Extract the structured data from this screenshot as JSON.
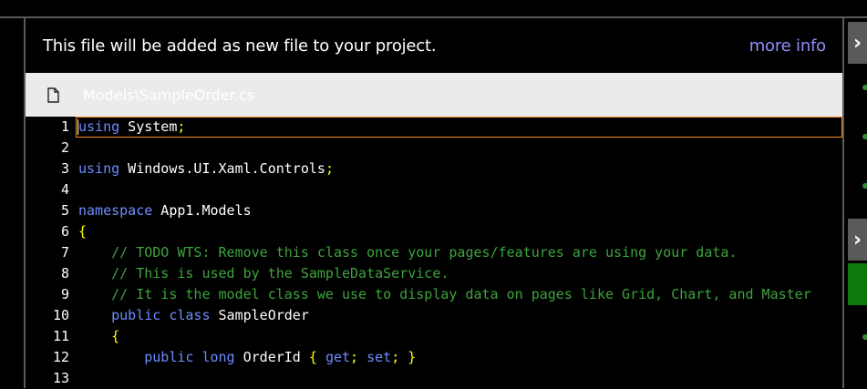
{
  "banner": {
    "message": "This file will be added as new file to your project.",
    "more_info_label": "more info"
  },
  "file": {
    "icon": "document-icon",
    "name": "Models\\SampleOrder.cs"
  },
  "editor": {
    "current_line": 1,
    "lines": [
      {
        "num": "1",
        "tokens": [
          {
            "t": "using",
            "c": "k"
          },
          {
            "t": " System",
            "c": "n"
          },
          {
            "t": ";",
            "c": "p"
          }
        ]
      },
      {
        "num": "2",
        "tokens": []
      },
      {
        "num": "3",
        "tokens": [
          {
            "t": "using",
            "c": "k"
          },
          {
            "t": " Windows.UI.Xaml.Controls",
            "c": "n"
          },
          {
            "t": ";",
            "c": "p"
          }
        ]
      },
      {
        "num": "4",
        "tokens": []
      },
      {
        "num": "5",
        "tokens": [
          {
            "t": "namespace",
            "c": "k"
          },
          {
            "t": " App1.Models",
            "c": "n"
          }
        ]
      },
      {
        "num": "6",
        "tokens": [
          {
            "t": "{",
            "c": "p"
          }
        ]
      },
      {
        "num": "7",
        "tokens": [
          {
            "t": "    ",
            "c": "n"
          },
          {
            "t": "// TODO WTS: Remove this class once your pages/features are using your data.",
            "c": "c"
          }
        ]
      },
      {
        "num": "8",
        "tokens": [
          {
            "t": "    ",
            "c": "n"
          },
          {
            "t": "// This is used by the SampleDataService.",
            "c": "c"
          }
        ]
      },
      {
        "num": "9",
        "tokens": [
          {
            "t": "    ",
            "c": "n"
          },
          {
            "t": "// It is the model class we use to display data on pages like Grid, Chart, and Master",
            "c": "c"
          }
        ]
      },
      {
        "num": "10",
        "tokens": [
          {
            "t": "    ",
            "c": "n"
          },
          {
            "t": "public",
            "c": "k"
          },
          {
            "t": " ",
            "c": "n"
          },
          {
            "t": "class",
            "c": "k"
          },
          {
            "t": " SampleOrder",
            "c": "n"
          }
        ]
      },
      {
        "num": "11",
        "tokens": [
          {
            "t": "    ",
            "c": "n"
          },
          {
            "t": "{",
            "c": "p"
          }
        ]
      },
      {
        "num": "12",
        "tokens": [
          {
            "t": "        ",
            "c": "n"
          },
          {
            "t": "public",
            "c": "k"
          },
          {
            "t": " ",
            "c": "n"
          },
          {
            "t": "long",
            "c": "k"
          },
          {
            "t": " OrderId ",
            "c": "n"
          },
          {
            "t": "{",
            "c": "p"
          },
          {
            "t": " ",
            "c": "n"
          },
          {
            "t": "get",
            "c": "k"
          },
          {
            "t": ";",
            "c": "p"
          },
          {
            "t": " ",
            "c": "n"
          },
          {
            "t": "set",
            "c": "k"
          },
          {
            "t": ";",
            "c": "p"
          },
          {
            "t": " ",
            "c": "n"
          },
          {
            "t": "}",
            "c": "p"
          }
        ]
      },
      {
        "num": "13",
        "tokens": []
      }
    ]
  },
  "side": {
    "collapse_icon": "chevron-right-icon",
    "collapse_glyph": "›"
  },
  "colors": {
    "keyword": "#6d8cff",
    "comment": "#3da33d",
    "punctuation": "#ffff00",
    "link": "#8f8fff",
    "current_line_border": "#ff8c1a",
    "header_bg": "#ebebeb",
    "accent_green": "#0e7a0e"
  }
}
